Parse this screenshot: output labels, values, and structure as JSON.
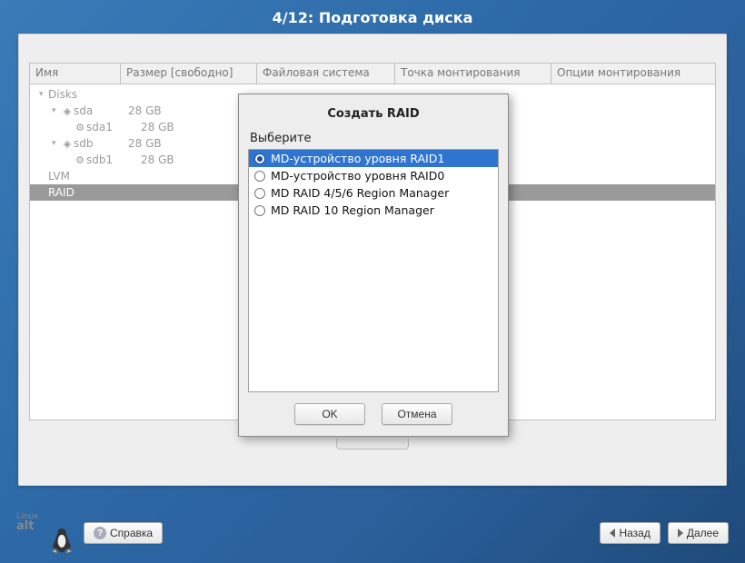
{
  "header": {
    "title": "4/12: Подготовка диска"
  },
  "table": {
    "columns": {
      "name": "Имя",
      "size": "Размер [свободно]",
      "fs": "Файловая система",
      "mount": "Точка монтирования",
      "opts": "Опции монтирования"
    }
  },
  "tree": {
    "disks_label": "Disks",
    "items": [
      {
        "name": "sda",
        "size": "28 GB",
        "icon": "disk"
      },
      {
        "name": "sda1",
        "size": "28 GB",
        "icon": "part",
        "child": true
      },
      {
        "name": "sdb",
        "size": "28 GB",
        "icon": "disk"
      },
      {
        "name": "sdb1",
        "size": "28 GB",
        "icon": "part",
        "child": true
      }
    ],
    "lvm_label": "LVM",
    "raid_label": "RAID"
  },
  "dialog": {
    "title": "Создать RAID",
    "choose_label": "Выберите",
    "options": [
      "MD-устройство уровня RAID1",
      "MD-устройство уровня RAID0",
      "MD RAID 4/5/6 Region Manager",
      "MD RAID 10 Region Manager"
    ],
    "selected_index": 0,
    "ok": "OK",
    "cancel": "Отмена"
  },
  "footer": {
    "logo_small": "Linux",
    "logo_big": "alt",
    "help": "Справка",
    "back": "Назад",
    "next": "Далее"
  }
}
